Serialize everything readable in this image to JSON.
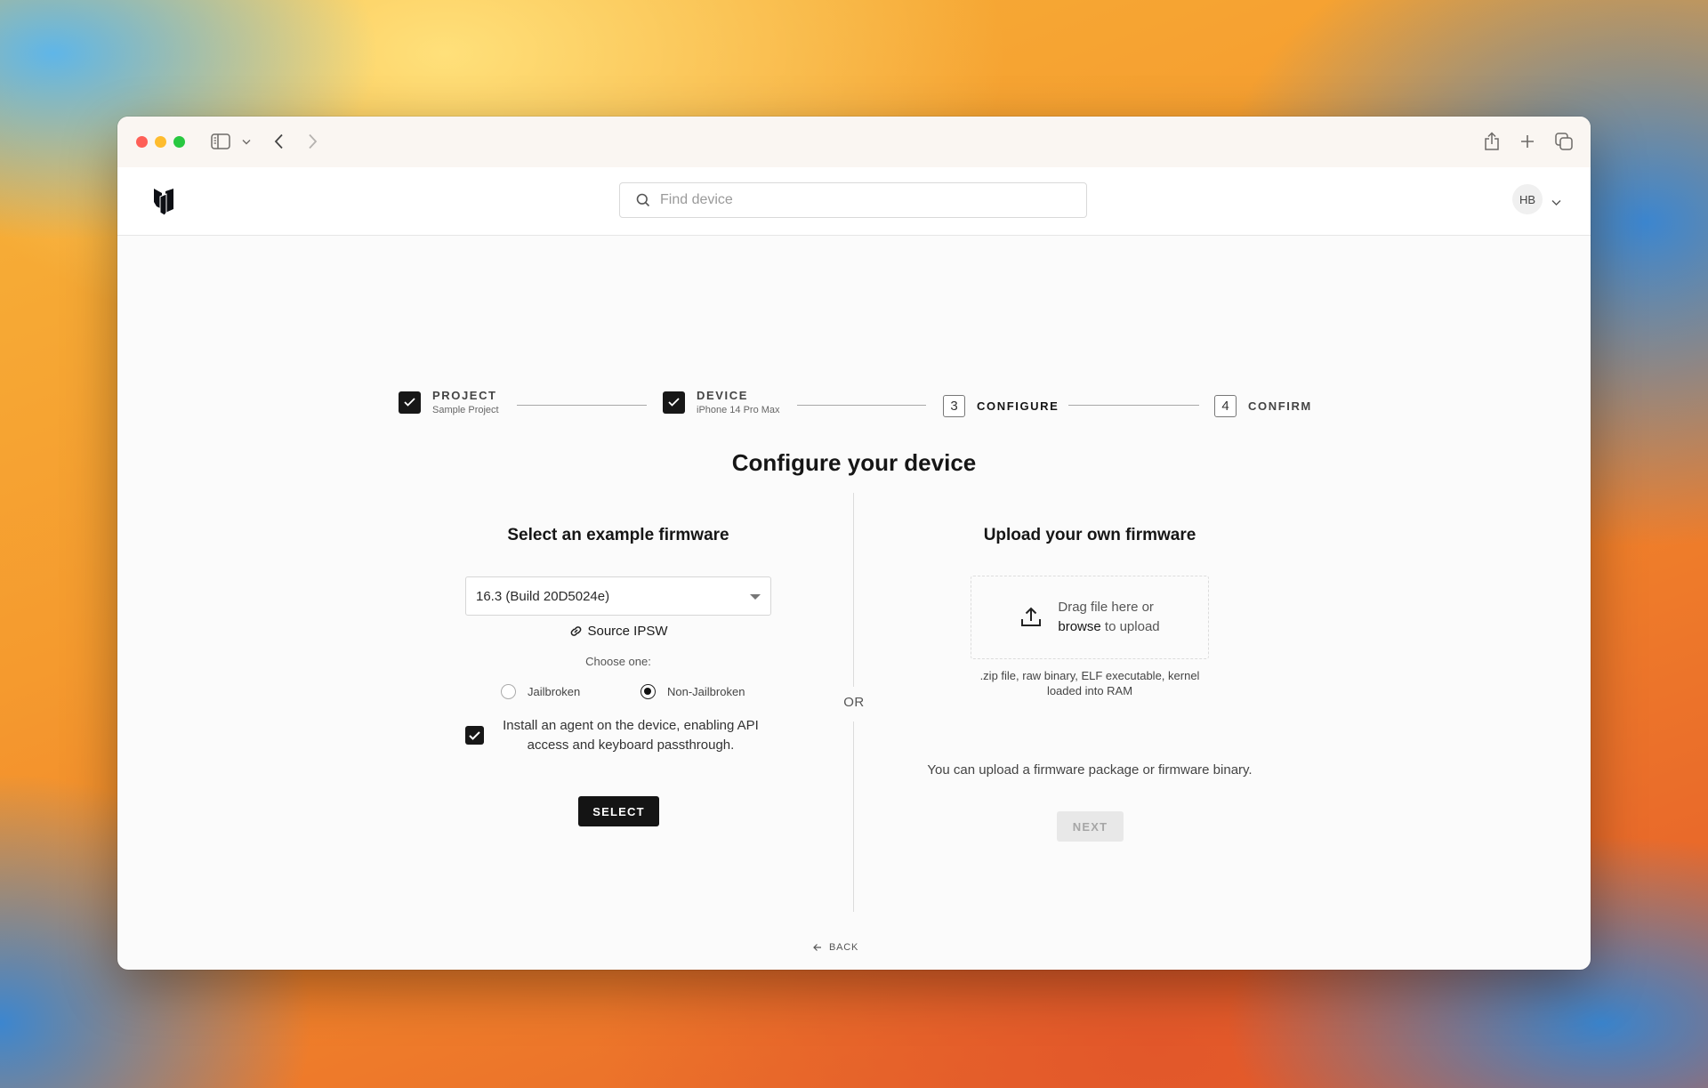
{
  "browser": {
    "toolbar_icons": [
      "sidebar-icon",
      "chevron-down-icon",
      "back-arrow-icon",
      "forward-arrow-icon",
      "share-icon",
      "new-tab-icon",
      "tabs-overview-icon"
    ]
  },
  "header": {
    "search_placeholder": "Find device",
    "search_value": "",
    "user_initials": "HB"
  },
  "stepper": {
    "steps": [
      {
        "number": "1",
        "label": "PROJECT",
        "sublabel": "Sample Project",
        "state": "complete"
      },
      {
        "number": "2",
        "label": "DEVICE",
        "sublabel": "iPhone 14 Pro Max",
        "state": "complete"
      },
      {
        "number": "3",
        "label": "CONFIGURE",
        "sublabel": "",
        "state": "active"
      },
      {
        "number": "4",
        "label": "CONFIRM",
        "sublabel": "",
        "state": "pending"
      }
    ]
  },
  "page": {
    "title": "Configure your device",
    "or_label": "OR",
    "back_label": "BACK"
  },
  "example_firmware": {
    "heading": "Select an example firmware",
    "selected_firmware": "16.3 (Build 20D5024e)",
    "source_link": "Source IPSW",
    "choose_label": "Choose one:",
    "options": [
      {
        "label": "Jailbroken",
        "selected": false
      },
      {
        "label": "Non-Jailbroken",
        "selected": true
      }
    ],
    "agent_checkbox": {
      "checked": true,
      "label": "Install an agent on the device, enabling API access and keyboard passthrough."
    },
    "select_button": "SELECT"
  },
  "upload_firmware": {
    "heading": "Upload your own firmware",
    "drop_text_1": "Drag file here or",
    "browse_link": "browse",
    "drop_text_2": " to upload",
    "formats": ".zip file, raw binary, ELF executable, kernel loaded into RAM",
    "note": "You can upload a firmware package or firmware binary.",
    "next_button": "NEXT",
    "next_enabled": false
  },
  "colors": {
    "accent_dark": "#171717",
    "disabled_bg": "#e8e8e8",
    "disabled_text": "#a6a6a6"
  }
}
